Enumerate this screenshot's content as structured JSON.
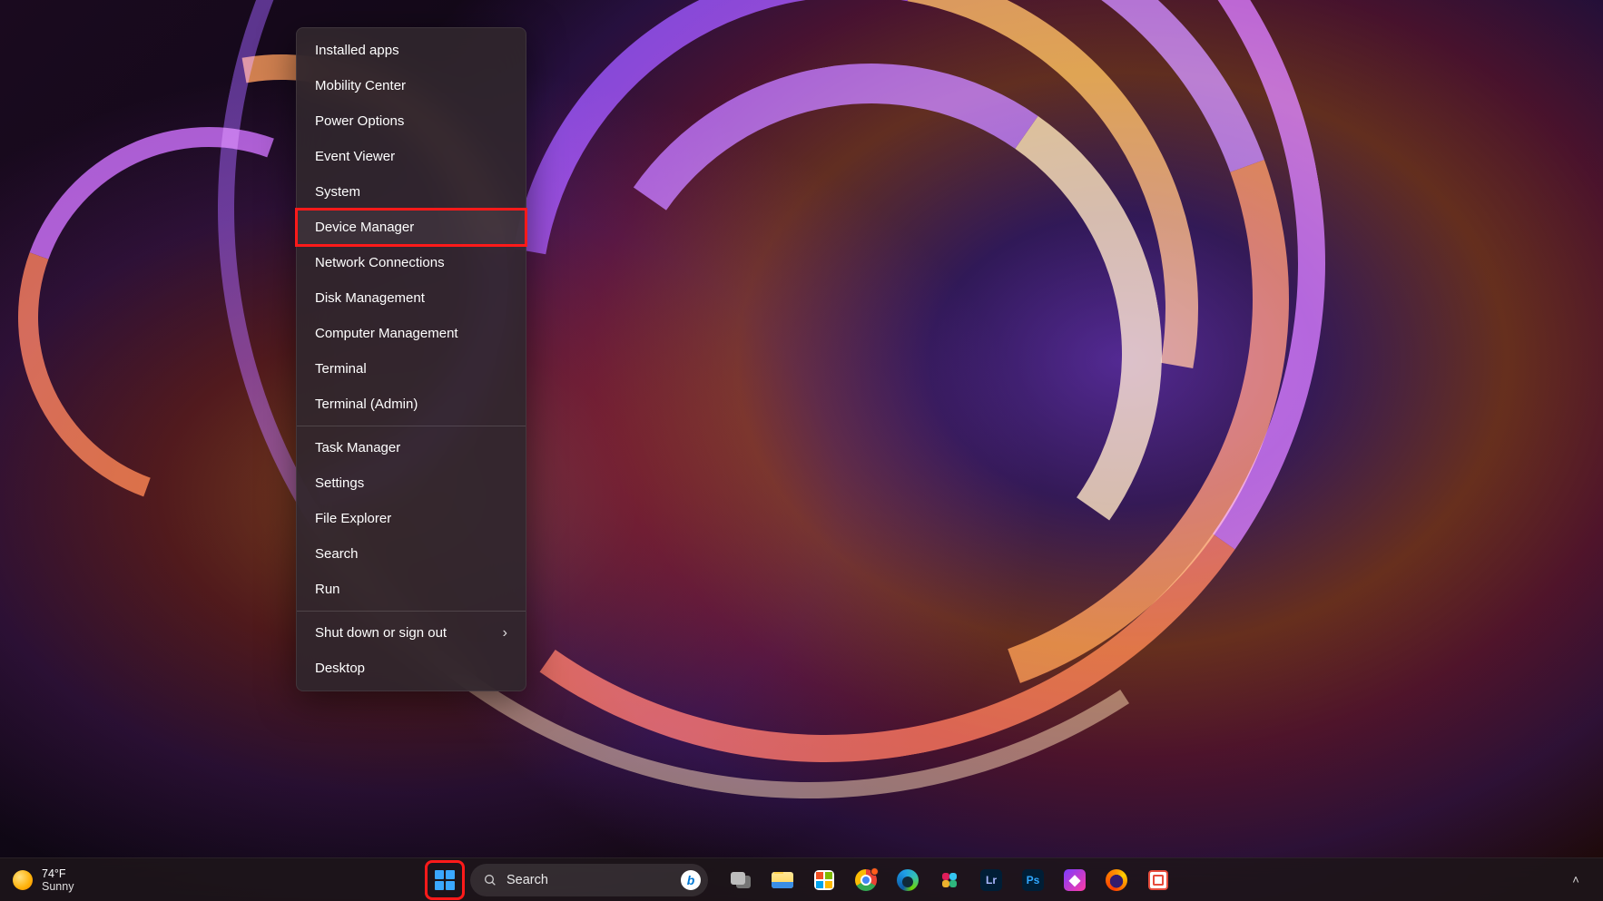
{
  "context_menu": {
    "groups": [
      [
        {
          "id": "installed-apps",
          "label": "Installed apps"
        },
        {
          "id": "mobility-center",
          "label": "Mobility Center"
        },
        {
          "id": "power-options",
          "label": "Power Options"
        },
        {
          "id": "event-viewer",
          "label": "Event Viewer"
        },
        {
          "id": "system",
          "label": "System"
        },
        {
          "id": "device-manager",
          "label": "Device Manager",
          "highlighted": true
        },
        {
          "id": "network-connections",
          "label": "Network Connections"
        },
        {
          "id": "disk-management",
          "label": "Disk Management"
        },
        {
          "id": "computer-management",
          "label": "Computer Management"
        },
        {
          "id": "terminal",
          "label": "Terminal"
        },
        {
          "id": "terminal-admin",
          "label": "Terminal (Admin)"
        }
      ],
      [
        {
          "id": "task-manager",
          "label": "Task Manager"
        },
        {
          "id": "settings",
          "label": "Settings"
        },
        {
          "id": "file-explorer",
          "label": "File Explorer"
        },
        {
          "id": "search",
          "label": "Search"
        },
        {
          "id": "run",
          "label": "Run"
        }
      ],
      [
        {
          "id": "shutdown-signout",
          "label": "Shut down or sign out",
          "submenu": true
        },
        {
          "id": "desktop",
          "label": "Desktop"
        }
      ]
    ]
  },
  "taskbar": {
    "weather": {
      "temp": "74°F",
      "desc": "Sunny"
    },
    "search_placeholder": "Search",
    "pinned": [
      {
        "id": "task-view",
        "name": "Task View"
      },
      {
        "id": "file-explorer",
        "name": "File Explorer"
      },
      {
        "id": "microsoft-store",
        "name": "Microsoft Store"
      },
      {
        "id": "google-chrome",
        "name": "Google Chrome",
        "badge": true
      },
      {
        "id": "microsoft-edge",
        "name": "Microsoft Edge"
      },
      {
        "id": "slack",
        "name": "Slack"
      },
      {
        "id": "lightroom",
        "name": "Lr",
        "label": "Lr"
      },
      {
        "id": "photoshop",
        "name": "Ps",
        "label": "Ps"
      },
      {
        "id": "affinity-photo",
        "name": "Affinity Photo"
      },
      {
        "id": "firefox",
        "name": "Firefox"
      },
      {
        "id": "snipping-tool",
        "name": "Snipping Tool"
      }
    ]
  },
  "highlight_color": "#ff1a1a"
}
